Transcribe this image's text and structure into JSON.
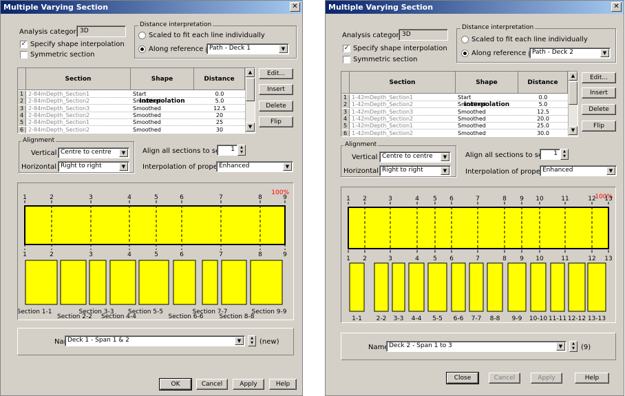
{
  "left": {
    "title": "Multiple Varying Section",
    "analysis_label": "Analysis category",
    "analysis_value": "3D",
    "specify_label": "Specify shape interpolation",
    "symmetric_label": "Symmetric section",
    "distance_legend": "Distance interpretation",
    "radio1": "Scaled to fit each line individually",
    "radio2": "Along reference path",
    "path_value": "Path - Deck 1",
    "headers": [
      "Section",
      "Shape Interpolation",
      "Distance"
    ],
    "rows": [
      [
        "1",
        "2-84mDepth_Section1",
        "Start",
        "0.0"
      ],
      [
        "2",
        "2-84mDepth_Section2",
        "Smoothed",
        "5.0"
      ],
      [
        "3",
        "2-84mDepth_Section3",
        "Smoothed",
        "12.5"
      ],
      [
        "4",
        "2-84mDepth_Section2",
        "Smoothed",
        "20"
      ],
      [
        "5",
        "2-84mDepth_Section1",
        "Smoothed",
        "25"
      ],
      [
        "6",
        "2-84mDepth_Section2",
        "Smoothed",
        "30"
      ]
    ],
    "side_buttons": [
      "Edit...",
      "Insert",
      "Delete",
      "Flip"
    ],
    "alignment_legend": "Alignment",
    "vertical_label": "Vertical",
    "vertical_value": "Centre to centre",
    "horizontal_label": "Horizontal",
    "horizontal_value": "Right to right",
    "align_all_label": "Align all sections to section",
    "align_value": "1",
    "interp_label": "Interpolation of properties",
    "interp_value": "Enhanced",
    "percent": "100%",
    "ticks": [
      "1",
      "2",
      "3",
      "4",
      "5",
      "6",
      "7",
      "8",
      "9"
    ],
    "section_labels": [
      "Section 1-1",
      "Section 2-2",
      "Section 3-3",
      "Section 4-4",
      "Section 5-5",
      "Section 6-6",
      "Section 7-7",
      "Section 8-8",
      "Section 9-9"
    ],
    "name_label": "Name",
    "name_value": "Deck 1 - Span 1 & 2",
    "name_status": "(new)",
    "buttons": [
      "OK",
      "Cancel",
      "Apply",
      "Help"
    ]
  },
  "right": {
    "title": "Multiple Varying Section",
    "analysis_label": "Analysis category",
    "analysis_value": "3D",
    "specify_label": "Specify shape interpolation",
    "symmetric_label": "Symmetric section",
    "distance_legend": "Distance interpretation",
    "radio1": "Scaled to fit each line individually",
    "radio2": "Along reference path",
    "path_value": "Path - Deck 2",
    "headers": [
      "Section",
      "Shape Interpolation",
      "Distance"
    ],
    "rows": [
      [
        "1",
        "1-42mDepth_Section1",
        "Start",
        "0.0"
      ],
      [
        "2",
        "1-42mDepth_Section2",
        "Smoothed",
        "5.0"
      ],
      [
        "3",
        "1-42mDepth_Section3",
        "Smoothed",
        "12.5"
      ],
      [
        "4",
        "1-42mDepth_Section2",
        "Smoothed",
        "20.0"
      ],
      [
        "5",
        "1-42mDepth_Section1",
        "Smoothed",
        "25.0"
      ],
      [
        "6",
        "1-42mDepth_Section2",
        "Smoothed",
        "30.0"
      ]
    ],
    "side_buttons": [
      "Edit...",
      "Insert",
      "Delete",
      "Flip"
    ],
    "alignment_legend": "Alignment",
    "vertical_label": "Vertical",
    "vertical_value": "Centre to centre",
    "horizontal_label": "Horizontal",
    "horizontal_value": "Right to right",
    "align_all_label": "Align all sections to section",
    "align_value": "1",
    "interp_label": "Interpolation of properties",
    "interp_value": "Enhanced",
    "percent": "100%",
    "ticks": [
      "1",
      "2",
      "3",
      "4",
      "5",
      "6",
      "7",
      "8",
      "9",
      "10",
      "11",
      "12",
      "13"
    ],
    "section_labels": [
      "1-1",
      "2-2",
      "3-3",
      "4-4",
      "5-5",
      "6-6",
      "7-7",
      "8-8",
      "9-9",
      "10-10",
      "11-11",
      "12-12",
      "13-13"
    ],
    "name_label": "Name",
    "name_value": "Deck 2 - Span 1 to 3",
    "name_status": "(9)",
    "buttons": [
      "Close",
      "Cancel",
      "Apply",
      "Help"
    ]
  },
  "colors": {
    "section_fill": "#ffff00",
    "percent": "#ff0000",
    "title_bar": "#0a246a"
  },
  "icons": [
    "close-icon",
    "dropdown-arrow-icon",
    "spin-up-icon",
    "spin-down-icon",
    "scroll-up-icon",
    "scroll-down-icon",
    "checkmark-icon"
  ]
}
